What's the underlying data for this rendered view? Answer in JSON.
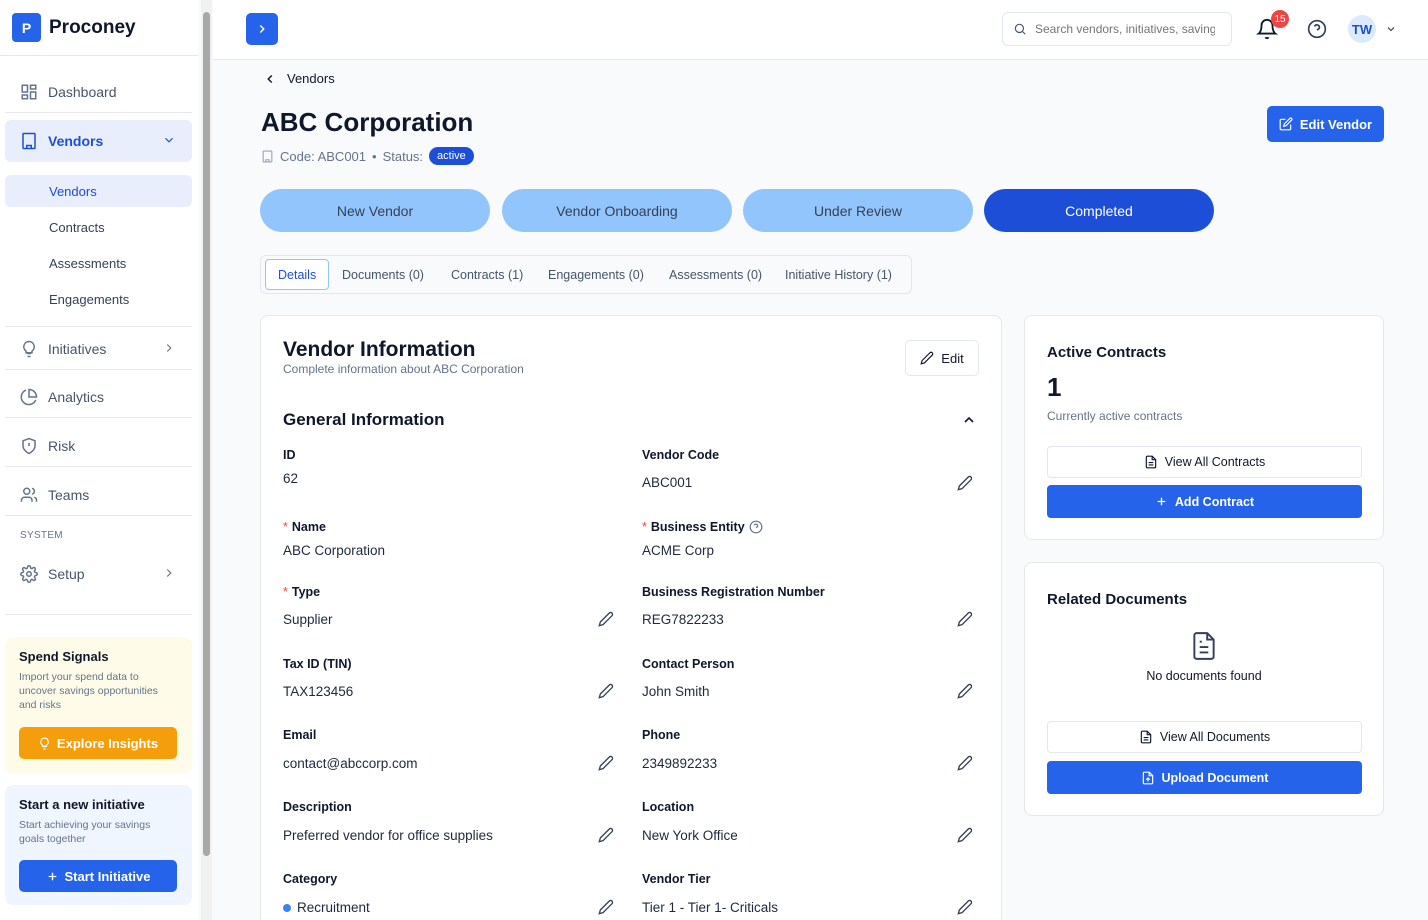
{
  "app": {
    "logo_letter": "P",
    "name": "Proconey"
  },
  "sidebar": {
    "items": [
      {
        "label": "Dashboard",
        "icon": "dashboard-icon"
      },
      {
        "label": "Vendors",
        "icon": "building-icon"
      },
      {
        "label": "Initiatives",
        "icon": "lightbulb-icon"
      },
      {
        "label": "Analytics",
        "icon": "pie-chart-icon"
      },
      {
        "label": "Risk",
        "icon": "shield-icon"
      },
      {
        "label": "Teams",
        "icon": "users-icon"
      },
      {
        "label": "Setup",
        "icon": "gear-icon"
      }
    ],
    "vendor_sub": [
      "Vendors",
      "Contracts",
      "Assessments",
      "Engagements"
    ],
    "system_label": "SYSTEM",
    "spend_card": {
      "title": "Spend Signals",
      "text": "Import your spend data to uncover savings opportunities and risks",
      "button": "Explore Insights"
    },
    "initiative_card": {
      "title": "Start a new initiative",
      "text": "Start achieving your savings goals together",
      "button": "Start Initiative"
    }
  },
  "topbar": {
    "search_placeholder": "Search vendors, initiatives, savings...",
    "notification_count": "15",
    "user_initials": "TW"
  },
  "breadcrumb": {
    "back_label": "Vendors"
  },
  "vendor": {
    "name": "ABC Corporation",
    "code_text": "Code: ABC001",
    "separator": "•",
    "status_label": "Status:",
    "status": "active",
    "edit_button": "Edit Vendor"
  },
  "stages": [
    {
      "label": "New Vendor",
      "state": "done"
    },
    {
      "label": "Vendor Onboarding",
      "state": "done"
    },
    {
      "label": "Under Review",
      "state": "done"
    },
    {
      "label": "Completed",
      "state": "current"
    }
  ],
  "tabs": [
    "Details",
    "Documents (0)",
    "Contracts (1)",
    "Engagements (0)",
    "Assessments (0)",
    "Initiative History (1)"
  ],
  "info": {
    "title": "Vendor Information",
    "subtitle": "Complete information about ABC Corporation",
    "edit": "Edit",
    "section": "General Information",
    "fields": {
      "id": {
        "label": "ID",
        "value": "62"
      },
      "vendor_code": {
        "label": "Vendor Code",
        "value": "ABC001"
      },
      "name": {
        "label": "Name",
        "value": "ABC Corporation"
      },
      "business_entity": {
        "label": "Business Entity",
        "value": "ACME Corp"
      },
      "type": {
        "label": "Type",
        "value": "Supplier"
      },
      "brn": {
        "label": "Business Registration Number",
        "value": "REG7822233"
      },
      "tax_id": {
        "label": "Tax ID (TIN)",
        "value": "TAX123456"
      },
      "contact": {
        "label": "Contact Person",
        "value": "John Smith"
      },
      "email": {
        "label": "Email",
        "value": "contact@abccorp.com"
      },
      "phone": {
        "label": "Phone",
        "value": "2349892233"
      },
      "description": {
        "label": "Description",
        "value": "Preferred vendor for office supplies"
      },
      "location": {
        "label": "Location",
        "value": "New York Office"
      },
      "category": {
        "label": "Category",
        "value": "Recruitment"
      },
      "tier": {
        "label": "Vendor Tier",
        "value": "Tier 1 - Tier 1- Criticals"
      }
    }
  },
  "contracts_card": {
    "title": "Active Contracts",
    "count": "1",
    "subtitle": "Currently active contracts",
    "view_all": "View All Contracts",
    "add": "Add Contract"
  },
  "documents_card": {
    "title": "Related Documents",
    "empty": "No documents found",
    "view_all": "View All Documents",
    "upload": "Upload Document"
  },
  "colors": {
    "primary": "#2563eb",
    "stage_done": "#93c5fd",
    "warning": "#f59e0b",
    "badge": "#ef4444"
  }
}
